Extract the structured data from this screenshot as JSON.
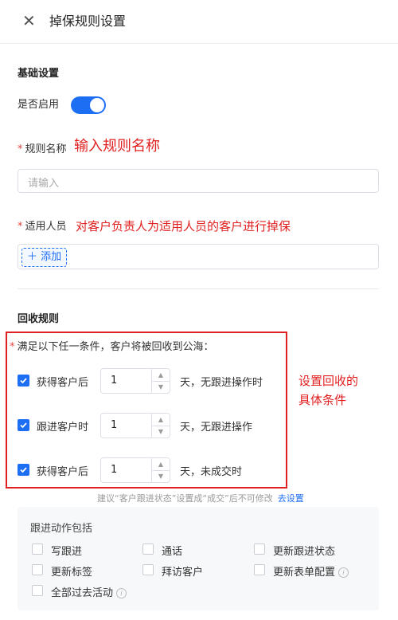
{
  "header": {
    "title": "掉保规则设置"
  },
  "basic": {
    "section_title": "基础设置",
    "enable_label": "是否启用",
    "rule_name_label": "规则名称",
    "rule_name_placeholder": "请输入",
    "applicable_label": "适用人员",
    "add_label": "添加"
  },
  "annotations": {
    "rule_name": "输入规则名称",
    "applicable": "对客户负责人为适用人员的客户进行掉保",
    "recycle": "设置回收的\n具体条件"
  },
  "recycle": {
    "section_title": "回收规则",
    "condition_label": "满足以下任一条件，客户将被回收到公海：",
    "rules": [
      {
        "label": "获得客户后",
        "value": "1",
        "tail": "天，无跟进操作时",
        "checked": true
      },
      {
        "label": "跟进客户时",
        "value": "1",
        "tail": "天，无跟进操作",
        "checked": true
      },
      {
        "label": "获得客户后",
        "value": "1",
        "tail": "天，未成交时",
        "checked": true
      }
    ],
    "hint": "建议“客户跟进状态”设置成“成交”后不可修改",
    "hint_link": "去设置"
  },
  "followup": {
    "title": "跟进动作包括",
    "options": [
      {
        "label": "写跟进"
      },
      {
        "label": "通话"
      },
      {
        "label": "更新跟进状态"
      },
      {
        "label": "更新标签"
      },
      {
        "label": "拜访客户"
      },
      {
        "label": "更新表单配置"
      },
      {
        "label": "全部过去活动"
      }
    ]
  },
  "colors": {
    "accent": "#1e6ef4",
    "annotation": "#e02020",
    "required": "#e64340"
  }
}
